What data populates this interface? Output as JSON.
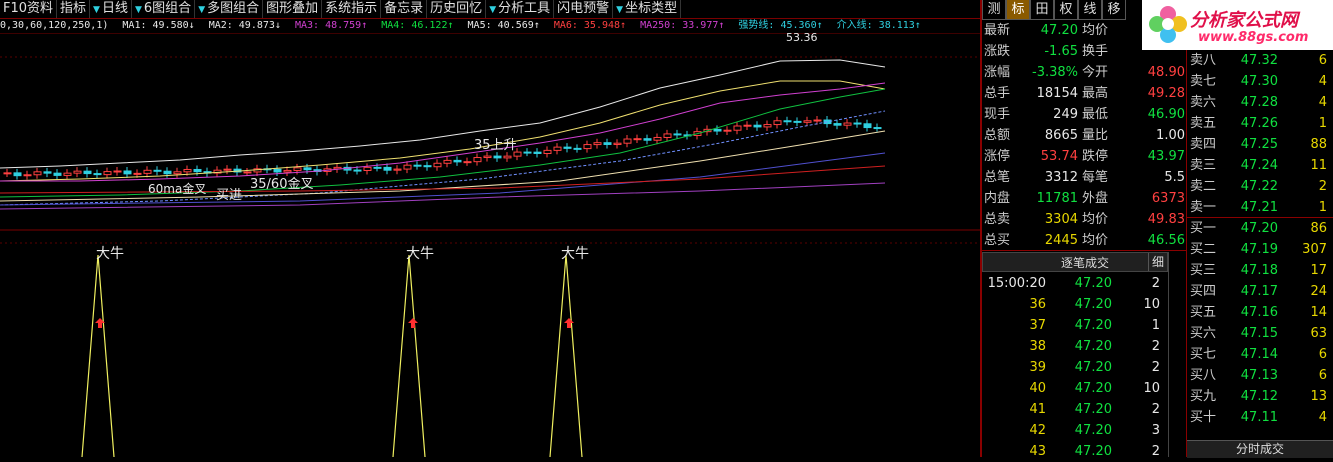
{
  "toolbar": [
    {
      "label": "F10资料",
      "arrow": false
    },
    {
      "label": "指标",
      "arrow": false
    },
    {
      "label": "日线",
      "arrow": true
    },
    {
      "label": "6图组合",
      "arrow": true
    },
    {
      "label": "多图组合",
      "arrow": true
    },
    {
      "label": "图形叠加",
      "arrow": false
    },
    {
      "label": "系统指示",
      "arrow": false
    },
    {
      "label": "备忘录",
      "arrow": false
    },
    {
      "label": "历史回忆",
      "arrow": false
    },
    {
      "label": "分析工具",
      "arrow": true
    },
    {
      "label": "闪电预警",
      "arrow": false
    },
    {
      "label": "坐标类型",
      "arrow": true
    }
  ],
  "ma_bar": {
    "params": "0,30,60,120,250,1)",
    "ma1": "MA1: 49.580↓",
    "ma2": "MA2: 49.873↓",
    "ma3": "MA3: 48.759↑",
    "ma4": "MA4: 46.122↑",
    "ma5": "MA5: 40.569↑",
    "ma6": "MA6: 35.948↑",
    "ma250": "MA250: 33.977↑",
    "strong": "强势线: 45.360↑",
    "entry": "介入线: 38.113↑",
    "colors": {
      "ma1": "#e8e8e8",
      "ma2": "#e8e8e8",
      "ma3": "#d040d0",
      "ma4": "#10e040",
      "ma5": "#e8e8e8",
      "ma6": "#ff4040",
      "ma250": "#d040d0",
      "strong": "#2fd0e0",
      "entry": "#2fd0e0"
    }
  },
  "annotations": {
    "peak": "53.36",
    "rise35": "35上升",
    "cross60": "60ma金叉",
    "buy": "买进",
    "cross3560": "35/60金叉",
    "bull": "大牛"
  },
  "tabs": [
    "测",
    "标",
    "田",
    "权",
    "线",
    "移"
  ],
  "logo": {
    "title": "分析家公式网",
    "url": "www.88gs.com"
  },
  "quote": [
    {
      "l1": "最新",
      "v1": "47.20",
      "c1": "#10e040",
      "l2": "均价",
      "v2": "",
      "c2": "#e8e8e8"
    },
    {
      "l1": "涨跌",
      "v1": "-1.65",
      "c1": "#10e040",
      "l2": "换手",
      "v2": "",
      "c2": "#e8e8e8"
    },
    {
      "l1": "涨幅",
      "v1": "-3.38%",
      "c1": "#10e040",
      "l2": "今开",
      "v2": "48.90",
      "c2": "#ff4040"
    },
    {
      "l1": "总手",
      "v1": "18154",
      "c1": "#e8e8e8",
      "l2": "最高",
      "v2": "49.28",
      "c2": "#ff4040"
    },
    {
      "l1": "现手",
      "v1": "249",
      "c1": "#e8e8e8",
      "l2": "最低",
      "v2": "46.90",
      "c2": "#10e040"
    },
    {
      "l1": "总额",
      "v1": "8665",
      "c1": "#e8e8e8",
      "l2": "量比",
      "v2": "1.00",
      "c2": "#e8e8e8"
    },
    {
      "l1": "涨停",
      "v1": "53.74",
      "c1": "#ff4040",
      "l2": "跌停",
      "v2": "43.97",
      "c2": "#10e040"
    },
    {
      "l1": "总笔",
      "v1": "3312",
      "c1": "#e8e8e8",
      "l2": "每笔",
      "v2": "5.5",
      "c2": "#e8e8e8"
    },
    {
      "l1": "内盘",
      "v1": "11781",
      "c1": "#10e040",
      "l2": "外盘",
      "v2": "6373",
      "c2": "#ff4040"
    },
    {
      "l1": "总卖",
      "v1": "3304",
      "c1": "#e8d800",
      "l2": "均价",
      "v2": "49.83",
      "c2": "#ff4040"
    },
    {
      "l1": "总买",
      "v1": "2445",
      "c1": "#e8d800",
      "l2": "均价",
      "v2": "46.56",
      "c2": "#10e040"
    }
  ],
  "orders": [
    {
      "label": "卖八",
      "price": "47.32",
      "vol": "6",
      "pc": "#10e040"
    },
    {
      "label": "卖七",
      "price": "47.30",
      "vol": "4",
      "pc": "#10e040"
    },
    {
      "label": "卖六",
      "price": "47.28",
      "vol": "4",
      "pc": "#10e040"
    },
    {
      "label": "卖五",
      "price": "47.26",
      "vol": "1",
      "pc": "#10e040"
    },
    {
      "label": "卖四",
      "price": "47.25",
      "vol": "88",
      "pc": "#10e040"
    },
    {
      "label": "卖三",
      "price": "47.24",
      "vol": "11",
      "pc": "#10e040"
    },
    {
      "label": "卖二",
      "price": "47.22",
      "vol": "2",
      "pc": "#10e040"
    },
    {
      "label": "卖一",
      "price": "47.21",
      "vol": "1",
      "pc": "#10e040"
    },
    {
      "label": "买一",
      "price": "47.20",
      "vol": "86",
      "pc": "#10e040"
    },
    {
      "label": "买二",
      "price": "47.19",
      "vol": "307",
      "pc": "#10e040"
    },
    {
      "label": "买三",
      "price": "47.18",
      "vol": "17",
      "pc": "#10e040"
    },
    {
      "label": "买四",
      "price": "47.17",
      "vol": "24",
      "pc": "#10e040"
    },
    {
      "label": "买五",
      "price": "47.16",
      "vol": "14",
      "pc": "#10e040"
    },
    {
      "label": "买六",
      "price": "47.15",
      "vol": "63",
      "pc": "#10e040"
    },
    {
      "label": "买七",
      "price": "47.14",
      "vol": "6",
      "pc": "#10e040"
    },
    {
      "label": "买八",
      "price": "47.13",
      "vol": "6",
      "pc": "#10e040"
    },
    {
      "label": "买九",
      "price": "47.12",
      "vol": "13",
      "pc": "#10e040"
    },
    {
      "label": "买十",
      "price": "47.11",
      "vol": "4",
      "pc": "#10e040"
    }
  ],
  "tick_header": {
    "title": "逐笔成交",
    "detail": "细"
  },
  "ticks": [
    {
      "time": "15:00:20",
      "price": "47.20",
      "vol": "2"
    },
    {
      "time": "36",
      "price": "47.20",
      "vol": "10"
    },
    {
      "time": "37",
      "price": "47.20",
      "vol": "1"
    },
    {
      "time": "38",
      "price": "47.20",
      "vol": "2"
    },
    {
      "time": "39",
      "price": "47.20",
      "vol": "2"
    },
    {
      "time": "40",
      "price": "47.20",
      "vol": "10"
    },
    {
      "time": "41",
      "price": "47.20",
      "vol": "2"
    },
    {
      "time": "42",
      "price": "47.20",
      "vol": "3"
    },
    {
      "time": "43",
      "price": "47.20",
      "vol": "2"
    }
  ],
  "bottom_tab": "分时成交"
}
